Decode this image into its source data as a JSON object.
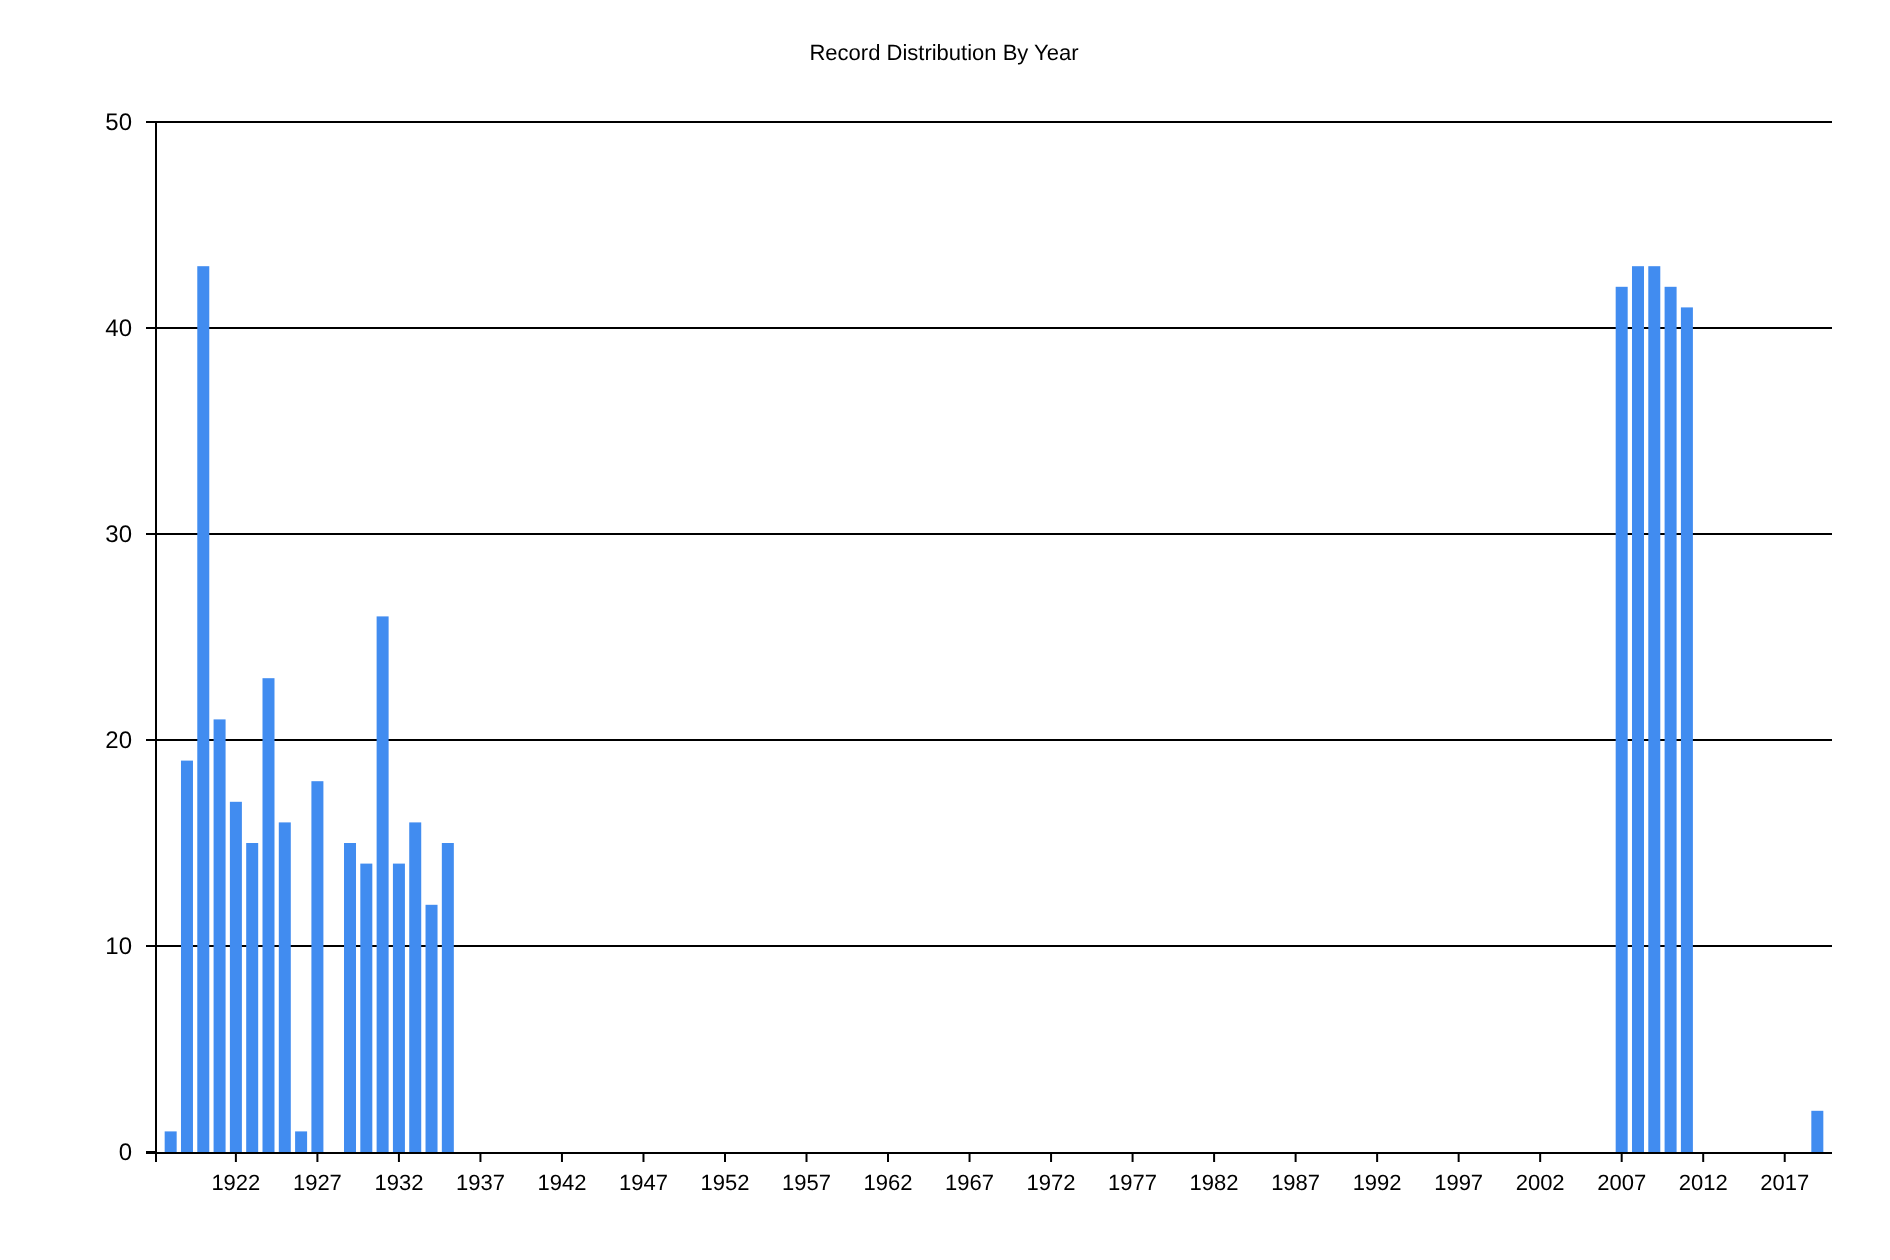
{
  "chart_data": {
    "type": "bar",
    "title": "Record Distribution By Year",
    "x": [
      1918,
      1919,
      1920,
      1921,
      1922,
      1923,
      1924,
      1925,
      1926,
      1927,
      1929,
      1930,
      1931,
      1932,
      1933,
      1934,
      1935,
      2007,
      2008,
      2009,
      2010,
      2011,
      2019
    ],
    "series": [
      {
        "color": "#418cf0",
        "values": [
          1,
          19,
          43,
          21,
          17,
          15,
          23,
          16,
          1,
          18,
          15,
          14,
          26,
          14,
          16,
          12,
          15,
          42,
          43,
          43,
          42,
          41,
          2
        ]
      }
    ],
    "xlim": [
      1917.1,
      2019.9
    ],
    "ylim": [
      0,
      50
    ],
    "xticks": [
      1922,
      1927,
      1932,
      1937,
      1942,
      1947,
      1952,
      1957,
      1962,
      1967,
      1972,
      1977,
      1982,
      1987,
      1992,
      1997,
      2002,
      2007,
      2012,
      2017
    ],
    "yticks": [
      0,
      10,
      20,
      30,
      40,
      50
    ],
    "grid": "y"
  }
}
